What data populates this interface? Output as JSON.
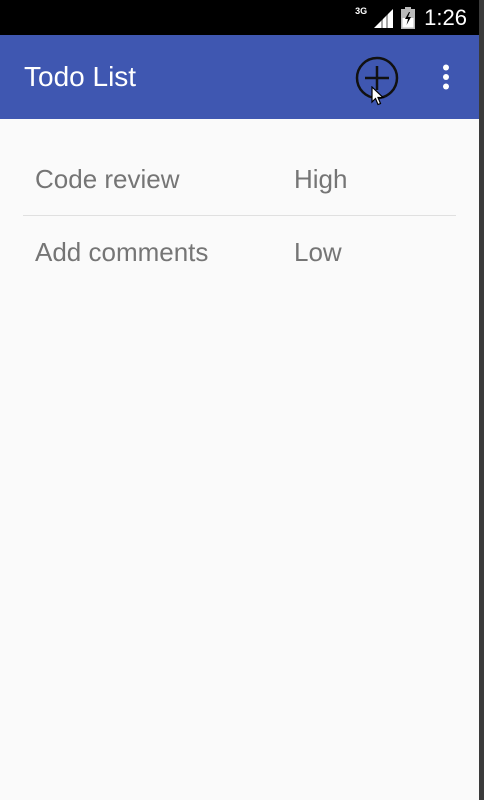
{
  "status_bar": {
    "network": "3G",
    "time": "1:26",
    "icons": [
      "signal-icon",
      "battery-icon"
    ]
  },
  "app_bar": {
    "title": "Todo List",
    "actions": [
      "add-circle-icon",
      "overflow-menu-icon"
    ],
    "color": "#3f57b1"
  },
  "todos": [
    {
      "task": "Code review",
      "priority": "High"
    },
    {
      "task": "Add comments",
      "priority": "Low"
    }
  ]
}
